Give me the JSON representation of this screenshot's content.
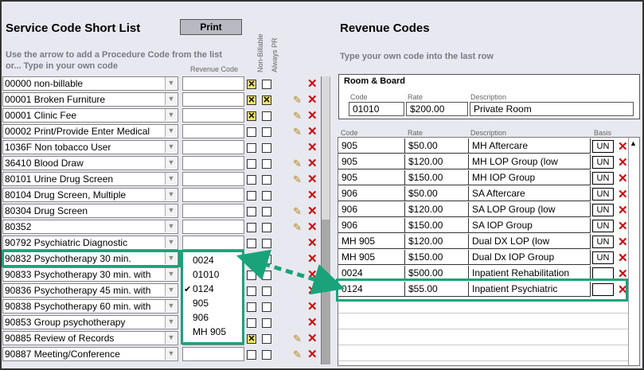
{
  "left": {
    "title": "Service Code Short List",
    "print_label": "Print",
    "hint_line1": "Use the arrow to add a Procedure Code from the list",
    "hint_line2": "or... Type in your own code",
    "col_revenue": "Revenue Code",
    "col_nonbillable": "Non-Billable",
    "col_alwayspr": "Always PR",
    "rows": [
      {
        "label": "00000 non-billable",
        "nb": true,
        "pr": false,
        "edit": false
      },
      {
        "label": "00001 Broken Furniture",
        "nb": true,
        "pr": true,
        "edit": true
      },
      {
        "label": "00001 Clinic Fee",
        "nb": true,
        "pr": false,
        "edit": true
      },
      {
        "label": "00002 Print/Provide Enter Medical",
        "nb": false,
        "pr": false,
        "edit": true
      },
      {
        "label": "1036F Non tobacco User",
        "nb": false,
        "pr": false,
        "edit": false
      },
      {
        "label": "36410 Blood Draw",
        "nb": false,
        "pr": false,
        "edit": true
      },
      {
        "label": "80101 Urine Drug Screen",
        "nb": false,
        "pr": false,
        "edit": true
      },
      {
        "label": "80104 Drug Screen, Multiple",
        "nb": false,
        "pr": false,
        "edit": false
      },
      {
        "label": "80304 Drug Screen",
        "nb": false,
        "pr": false,
        "edit": true
      },
      {
        "label": "80352",
        "nb": false,
        "pr": false,
        "edit": true
      },
      {
        "label": "90792 Psychiatric Diagnostic",
        "nb": false,
        "pr": false,
        "edit": false
      },
      {
        "label": "90832 Psychotherapy 30 min.",
        "nb": false,
        "pr": false,
        "edit": false
      },
      {
        "label": "90833 Psychotherapy 30 min. with",
        "nb": false,
        "pr": false,
        "edit": false
      },
      {
        "label": "90836 Psychotherapy 45 min. with",
        "nb": false,
        "pr": false,
        "edit": false
      },
      {
        "label": "90838 Psychotherapy 60 min. with",
        "nb": false,
        "pr": false,
        "edit": false
      },
      {
        "label": "90853 Group psychotherapy",
        "nb": false,
        "pr": false,
        "edit": false
      },
      {
        "label": "90885 Review of Records",
        "nb": true,
        "pr": false,
        "edit": true
      },
      {
        "label": "90887 Meeting/Conference",
        "nb": false,
        "pr": false,
        "edit": true
      }
    ],
    "dropdown_options": [
      "0024",
      "01010",
      "0124",
      "905",
      "906",
      "MH 905"
    ],
    "dropdown_selected": "0124"
  },
  "right": {
    "title": "Revenue Codes",
    "hint": "Type your own code into the last row",
    "room_board": {
      "title": "Room & Board",
      "code_label": "Code",
      "rate_label": "Rate",
      "desc_label": "Description",
      "code": "01010",
      "rate": "$200.00",
      "description": "Private Room"
    },
    "col_code": "Code",
    "col_rate": "Rate",
    "col_desc": "Description",
    "col_basis": "Basis",
    "rows": [
      {
        "code": "905",
        "rate": "$50.00",
        "desc": "MH Aftercare",
        "basis": "UN"
      },
      {
        "code": "905",
        "rate": "$120.00",
        "desc": "MH LOP Group (low",
        "basis": "UN"
      },
      {
        "code": "905",
        "rate": "$150.00",
        "desc": "MH IOP Group",
        "basis": "UN"
      },
      {
        "code": "906",
        "rate": "$50.00",
        "desc": "SA Aftercare",
        "basis": "UN"
      },
      {
        "code": "906",
        "rate": "$120.00",
        "desc": "SA LOP Group (low",
        "basis": "UN"
      },
      {
        "code": "906",
        "rate": "$150.00",
        "desc": "SA IOP Group",
        "basis": "UN"
      },
      {
        "code": "MH 905",
        "rate": "$120.00",
        "desc": "Dual DX LOP (low",
        "basis": "UN"
      },
      {
        "code": "MH 905",
        "rate": "$150.00",
        "desc": "Dual Dx IOP Group",
        "basis": "UN"
      },
      {
        "code": "0024",
        "rate": "$500.00",
        "desc": "Inpatient Rehabilitation",
        "basis": ""
      },
      {
        "code": "0124",
        "rate": "$55.00",
        "desc": "Inpatient Psychiatric",
        "basis": ""
      }
    ]
  },
  "colors": {
    "highlight": "#1aa37a",
    "delete": "#d40000",
    "checked": "#f4e36a"
  }
}
